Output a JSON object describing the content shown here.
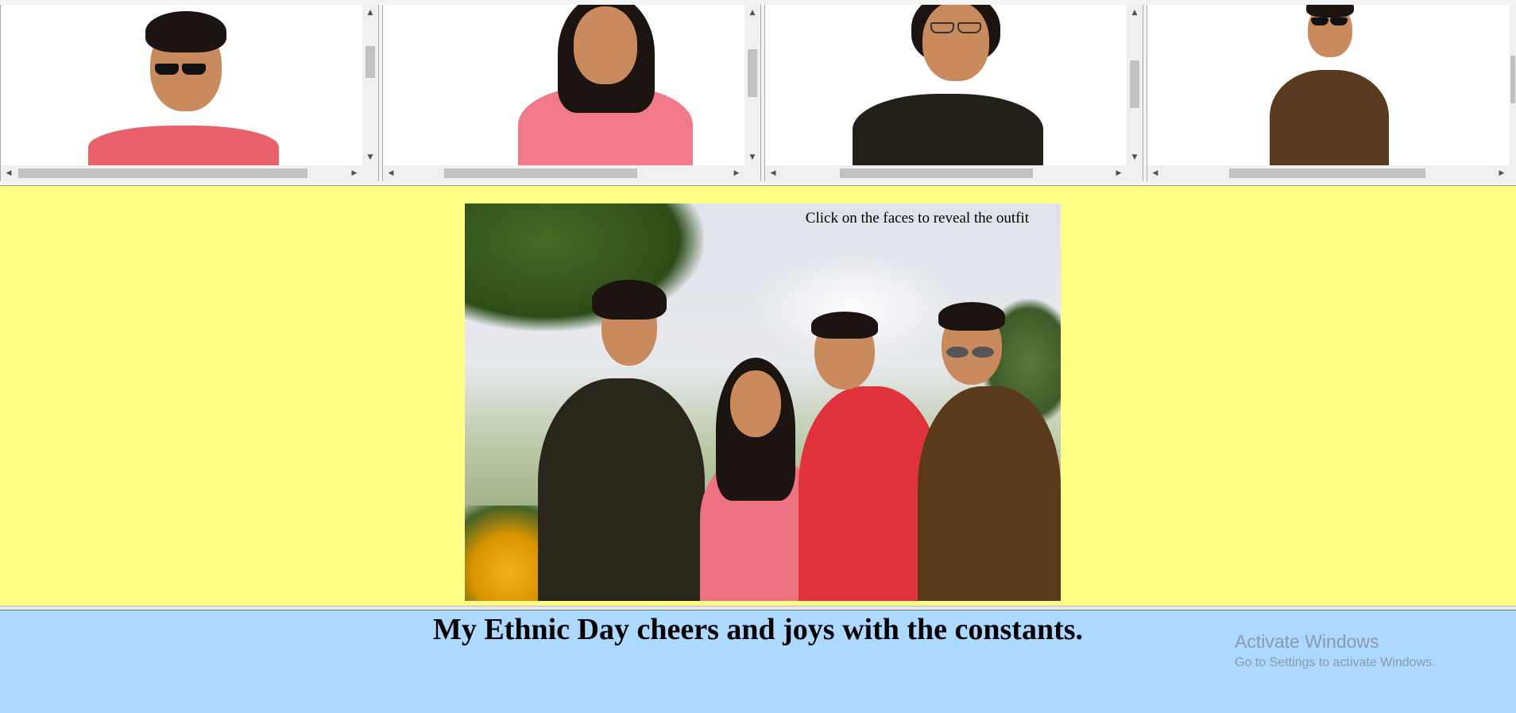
{
  "frames": [
    {
      "name": "frame-person-1",
      "shirt_color": "#e8616a",
      "hair_style": "curly",
      "glasses": "sunglasses"
    },
    {
      "name": "frame-person-2",
      "shirt_color": "#f07a88",
      "hair_style": "long",
      "glasses": "none"
    },
    {
      "name": "frame-person-3",
      "shirt_color": "#222018",
      "hair_style": "long-wavy",
      "glasses": "clear"
    },
    {
      "name": "frame-person-4",
      "shirt_color": "#5a3a1e",
      "hair_style": "short",
      "glasses": "sunglasses"
    }
  ],
  "main": {
    "caption": "Click on the faces to reveal the outfit",
    "photo_description_colors": {
      "sky": "#e3e6ec",
      "trees": "#3a5a22",
      "kurta_red": "#e0323a",
      "kurta_pink": "#ee7282",
      "kurta_black": "#2a261c",
      "shirt_brown": "#5a3a1a"
    }
  },
  "footer": {
    "title": "My Ethnic Day cheers and joys with the constants."
  },
  "watermark": {
    "line1": "Activate Windows",
    "line2": "Go to Settings to activate Windows."
  },
  "colors": {
    "mid_background": "#ffff88",
    "footer_background": "#add8ff"
  }
}
